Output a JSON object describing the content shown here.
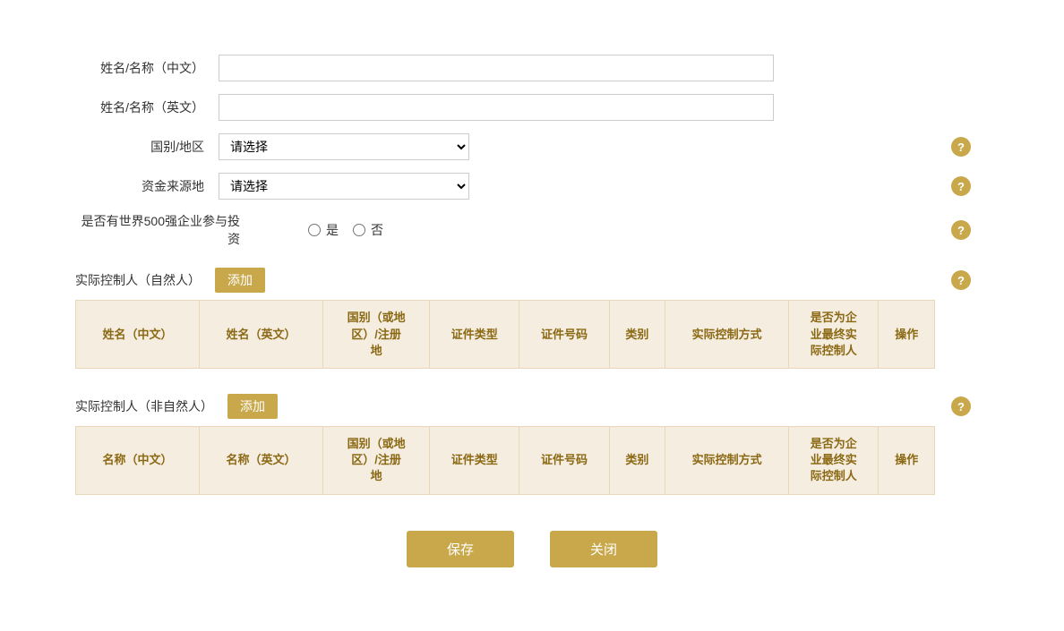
{
  "form": {
    "name_cn_label": "姓名/名称（中文）",
    "name_en_label": "姓名/名称（英文）",
    "country_label": "国别/地区",
    "fund_source_label": "资金来源地",
    "fortune500_label": "是否有世界500强企业参与投资",
    "country_placeholder": "请选择",
    "fund_source_placeholder": "请选择",
    "fortune500_yes": "是",
    "fortune500_no": "否"
  },
  "natural_person": {
    "section_title": "实际控制人（自然人）",
    "add_btn": "添加",
    "columns": [
      "姓名（中文）",
      "姓名（英文）",
      "国别（或地区）/注册地",
      "证件类型",
      "证件号码",
      "类别",
      "实际控制方式",
      "是否为企业最终实际控制人",
      "操作"
    ]
  },
  "non_natural_person": {
    "section_title": "实际控制人（非自然人）",
    "add_btn": "添加",
    "columns": [
      "名称（中文）",
      "名称（英文）",
      "国别（或地区）/注册地",
      "证件类型",
      "证件号码",
      "类别",
      "实际控制方式",
      "是否为企业最终实际控制人",
      "操作"
    ]
  },
  "buttons": {
    "save": "保存",
    "close": "关闭"
  },
  "help_icon": "?"
}
